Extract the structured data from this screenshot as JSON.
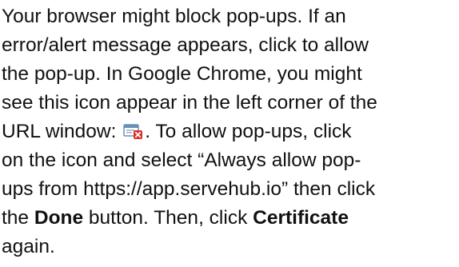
{
  "document": {
    "lines": [
      {
        "text": "Your browser might block pop-ups. If an"
      },
      {
        "text": "error/alert message appears, click to allow"
      },
      {
        "text": "the pop-up. In Google Chrome, you might"
      },
      {
        "text": "see this icon appear in the left corner of the"
      },
      {
        "before": "URL window: ",
        "icon": "popup-blocked-icon",
        "after": ". To allow pop-ups, click"
      },
      {
        "text": "on the icon and select “Always allow pop-"
      },
      {
        "text": "ups from https://app.servehub.io” then click"
      },
      {
        "before": "the ",
        "bold1": "Done",
        "middle": " button. Then, click ",
        "bold2": "Certificate"
      },
      {
        "text": "again."
      }
    ],
    "colors": {
      "text": "#111111",
      "icon_window": "#6b8fb5",
      "icon_badge": "#d93025"
    }
  }
}
